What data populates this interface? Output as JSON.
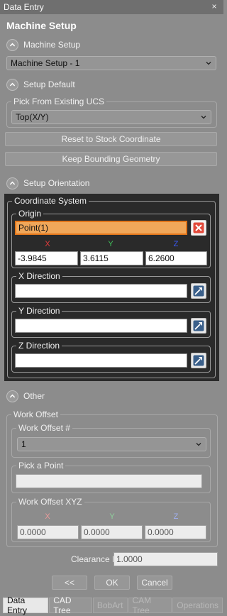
{
  "window": {
    "title": "Data Entry",
    "close_glyph": "×"
  },
  "panel_title": "Machine Setup",
  "sections": {
    "machine_setup": {
      "label": "Machine Setup",
      "combo_value": "Machine Setup - 1"
    },
    "setup_default": {
      "label": "Setup Default",
      "pick_ucs_label": "Pick From Existing UCS",
      "ucs_value": "Top(X/Y)",
      "reset_button": "Reset to Stock Coordinate",
      "keep_button": "Keep Bounding Geometry"
    },
    "setup_orientation": {
      "label": "Setup Orientation",
      "coord_system_label": "Coordinate System",
      "origin": {
        "label": "Origin",
        "point_value": "Point(1)",
        "x_label": "X",
        "y_label": "Y",
        "z_label": "Z",
        "x": "-3.9845",
        "y": "3.6115",
        "z": "6.2600"
      },
      "x_direction": {
        "label": "X Direction",
        "value": ""
      },
      "y_direction": {
        "label": "Y Direction",
        "value": ""
      },
      "z_direction": {
        "label": "Z Direction",
        "value": ""
      }
    },
    "other": {
      "label": "Other",
      "work_offset_label": "Work Offset",
      "work_offset_num_label": "Work Offset #",
      "work_offset_num_value": "1",
      "pick_point_label": "Pick a Point",
      "pick_point_value": "",
      "work_offset_xyz_label": "Work Offset XYZ",
      "x_label": "X",
      "y_label": "Y",
      "z_label": "Z",
      "x": "0.0000",
      "y": "0.0000",
      "z": "0.0000",
      "clearance_label": "Clearance Plane",
      "clearance_value": "1.0000"
    }
  },
  "buttons": {
    "prev": "<<",
    "ok": "OK",
    "cancel": "Cancel"
  },
  "tabs": [
    "Data Entry",
    "CAD Tree",
    "BobArt",
    "CAM Tree",
    "Operations"
  ],
  "colors": {
    "x_axis": "#e23b3b",
    "y_axis": "#3fbf5a",
    "z_axis": "#3b5bff",
    "origin_highlight": "#f0a75a"
  }
}
